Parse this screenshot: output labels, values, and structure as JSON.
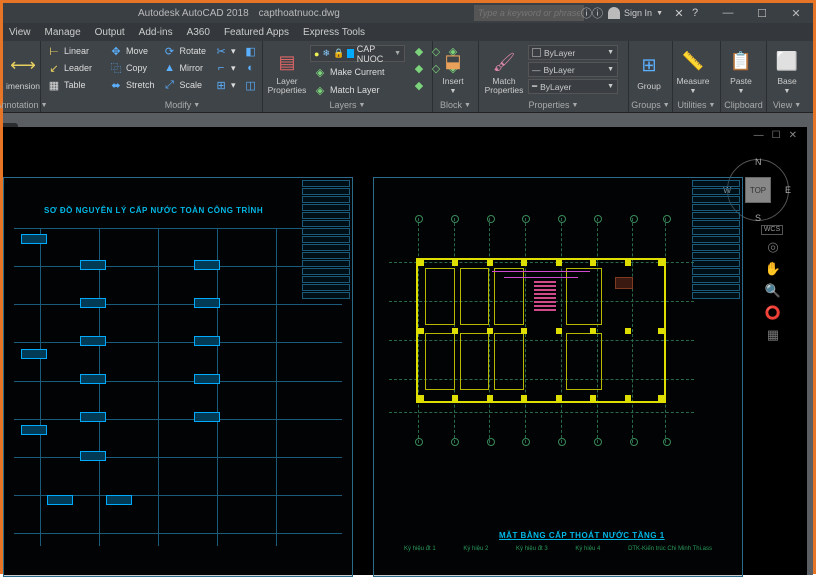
{
  "title": {
    "app": "Autodesk AutoCAD 2018",
    "file": "capthoatnuoc.dwg"
  },
  "search_placeholder": "Type a keyword or phrase",
  "signin": "Sign In",
  "menus": [
    "View",
    "Manage",
    "Output",
    "Add-ins",
    "A360",
    "Featured Apps",
    "Express Tools"
  ],
  "ribbon": {
    "annotation": {
      "label": "Annotation",
      "dimension": "imension",
      "linear": "Linear",
      "leader": "Leader",
      "table": "Table"
    },
    "modify": {
      "label": "Modify",
      "move": "Move",
      "copy": "Copy",
      "stretch": "Stretch",
      "rotate": "Rotate",
      "mirror": "Mirror",
      "scale": "Scale"
    },
    "layers": {
      "label": "Layers",
      "big": "Layer\nProperties",
      "current": "CAP NUOC",
      "make": "Make Current",
      "match": "Match Layer"
    },
    "block": {
      "label": "Block",
      "insert": "Insert"
    },
    "properties": {
      "label": "Properties",
      "match": "Match\nProperties",
      "bylayer": "ByLayer"
    },
    "groups": {
      "label": "Groups",
      "group": "Group"
    },
    "utilities": {
      "label": "Utilities",
      "measure": "Measure"
    },
    "clipboard": {
      "label": "Clipboard",
      "paste": "Paste"
    },
    "view": {
      "label": "View",
      "base": "Base"
    }
  },
  "navcube": {
    "face": "TOP",
    "n": "N",
    "s": "S",
    "e": "E",
    "w": "W",
    "wcs": "WCS"
  },
  "drawing": {
    "sheet1_title": "SƠ ĐỒ NGUYÊN LÝ CẤP NƯỚC TOÀN CÔNG TRÌNH",
    "sheet2_title": "MẶT BẰNG CẤP THOÁT NƯỚC TẦNG 1",
    "legend": [
      "Ký hiệu đt 1",
      "Ký hiệu 2",
      "Ký hiệu đt 3",
      "Ký hiệu 4",
      "DTK-Kiến trúc Chi Minh Thi.ass"
    ]
  }
}
